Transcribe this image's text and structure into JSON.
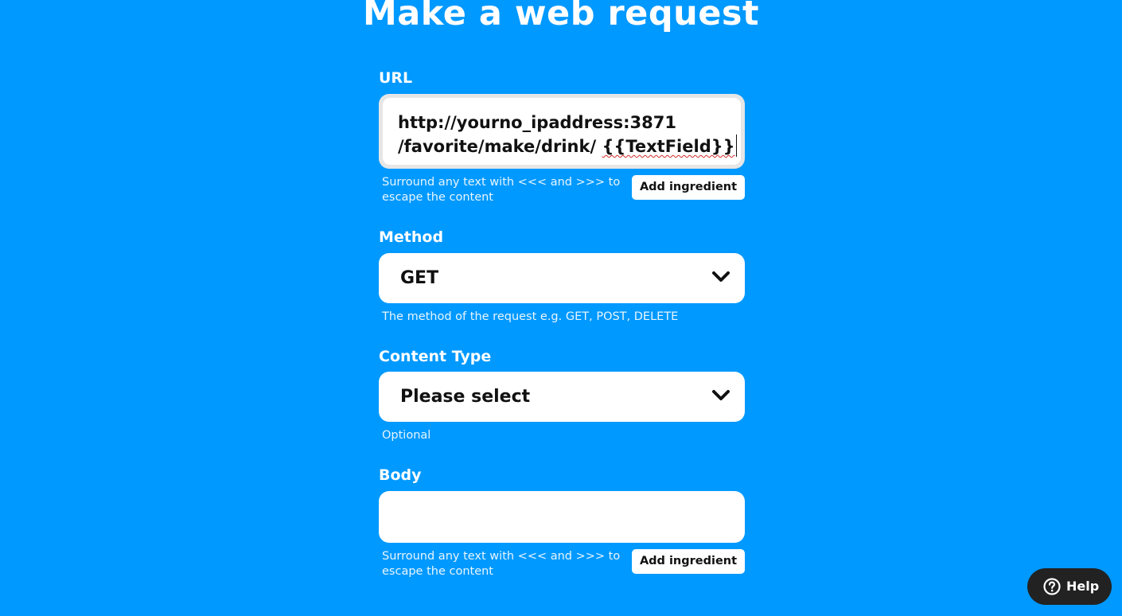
{
  "page": {
    "title": "Make a web request"
  },
  "url_field": {
    "label": "URL",
    "value_line1": "http://yourno_ipaddress:3871",
    "value_line2_prefix": "/favorite/make/drink/ ",
    "value_line2_ingredient": "{{TextField}}",
    "helper": "Surround any text with <<< and >>> to escape the content",
    "add_ingredient_label": "Add ingredient"
  },
  "method_field": {
    "label": "Method",
    "selected": "GET",
    "helper": "The method of the request e.g. GET, POST, DELETE"
  },
  "content_type_field": {
    "label": "Content Type",
    "selected": "Please select",
    "helper": "Optional"
  },
  "body_field": {
    "label": "Body",
    "value": "",
    "helper": "Surround any text with <<< and >>> to escape the content",
    "add_ingredient_label": "Add ingredient"
  },
  "help_button": {
    "label": "Help",
    "icon": "question-circle-icon"
  },
  "colors": {
    "background": "#0099ff",
    "field": "#ffffff",
    "help_button": "#222222"
  }
}
